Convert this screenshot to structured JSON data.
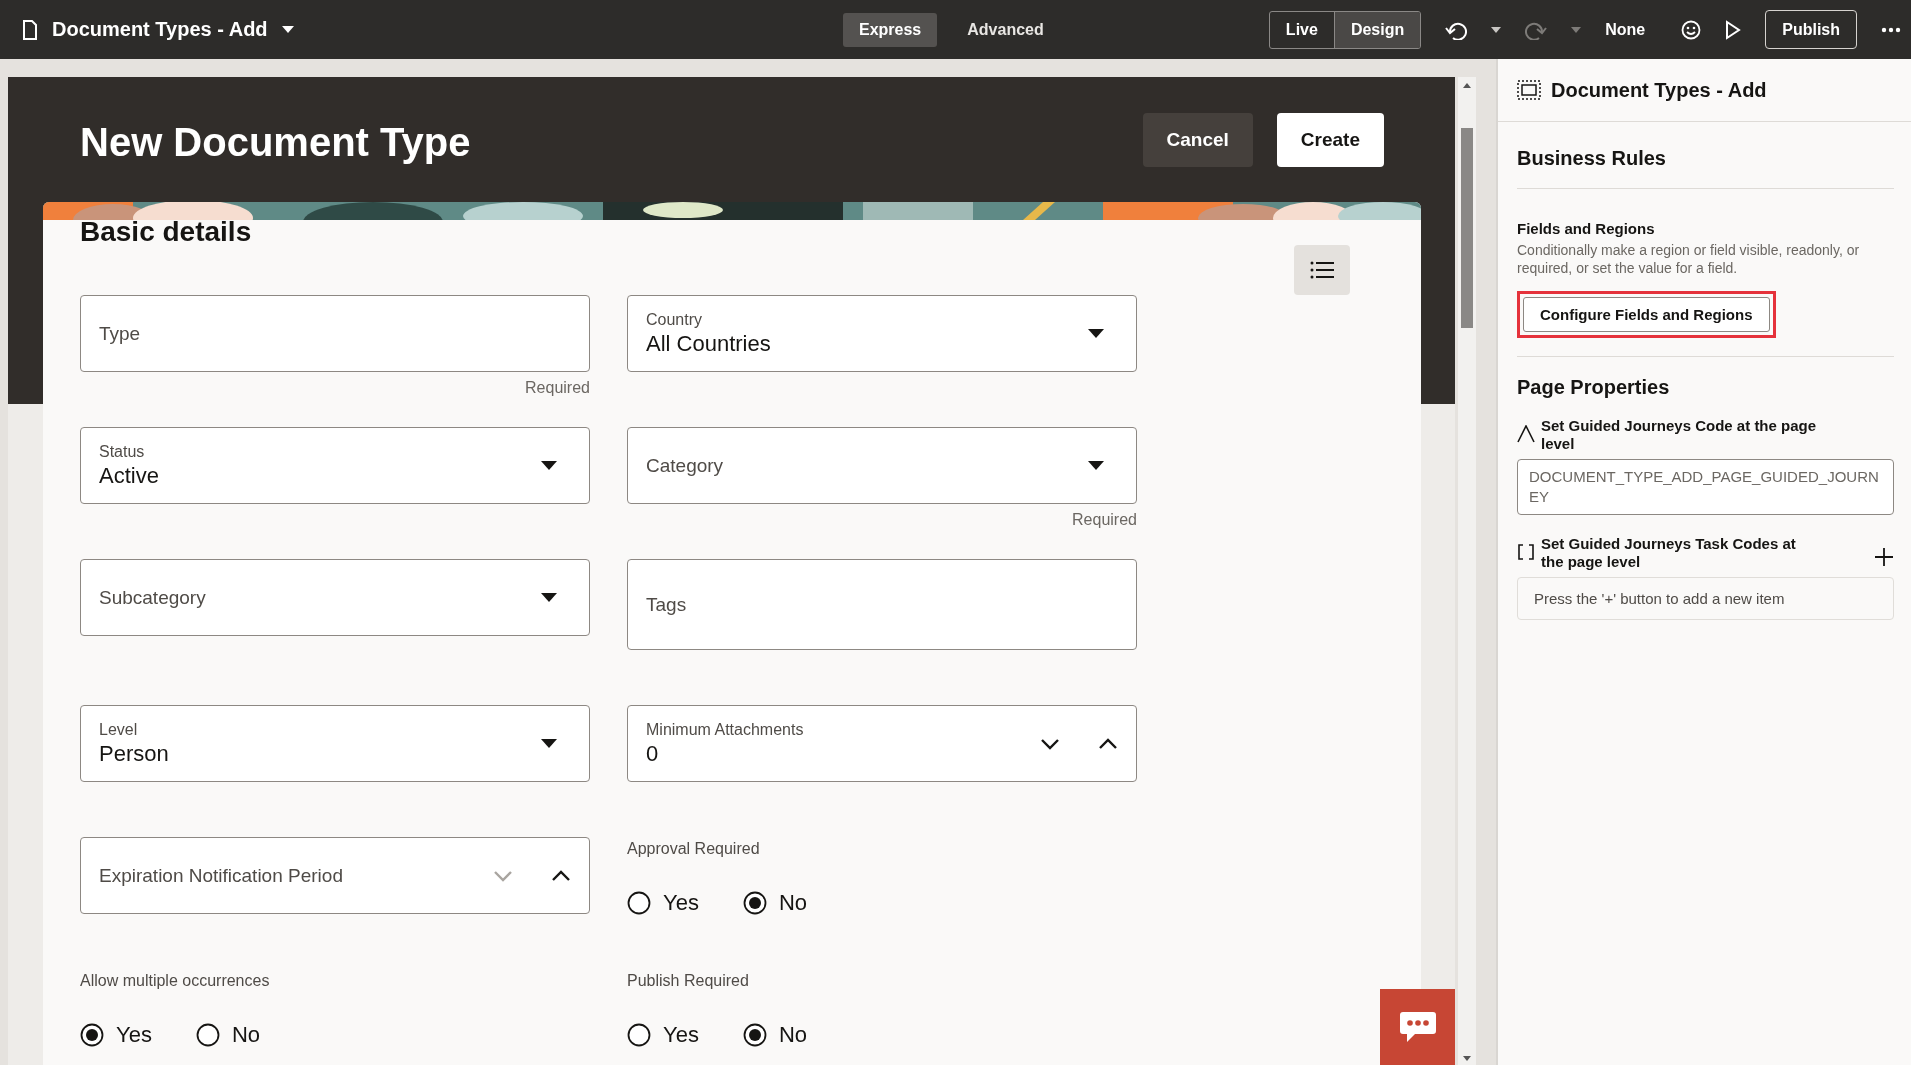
{
  "topbar": {
    "title": "Document Types - Add",
    "modes": [
      {
        "label": "Express",
        "selected": true
      },
      {
        "label": "Advanced",
        "selected": false
      }
    ],
    "views": [
      {
        "label": "Live",
        "selected": false
      },
      {
        "label": "Design",
        "selected": true
      }
    ],
    "sandbox": "None",
    "publish": "Publish"
  },
  "page": {
    "title": "New Document Type",
    "actions": [
      {
        "label": "Cancel",
        "kind": "secondary"
      },
      {
        "label": "Create",
        "kind": "primary"
      }
    ],
    "section": "Basic details",
    "fields": [
      {
        "kind": "text",
        "label": "Type",
        "helper": "Required"
      },
      {
        "kind": "select",
        "label": "Country",
        "value": "All Countries"
      },
      {
        "kind": "select",
        "label": "Status",
        "value": "Active"
      },
      {
        "kind": "select",
        "label": "Category",
        "helper": "Required"
      },
      {
        "kind": "select",
        "label": "Subcategory"
      },
      {
        "kind": "textarea",
        "label": "Tags"
      },
      {
        "kind": "select",
        "label": "Level",
        "value": "Person"
      },
      {
        "kind": "number",
        "label": "Minimum Attachments",
        "value": "0",
        "decrement_disabled": false
      },
      {
        "kind": "number",
        "label": "Expiration Notification Period",
        "decrement_disabled": true
      },
      {
        "kind": "radio",
        "label": "Approval Required",
        "options": [
          {
            "label": "Yes",
            "selected": false
          },
          {
            "label": "No",
            "selected": true
          }
        ]
      },
      {
        "kind": "radio",
        "label": "Allow multiple occurrences",
        "options": [
          {
            "label": "Yes",
            "selected": true
          },
          {
            "label": "No",
            "selected": false
          }
        ]
      },
      {
        "kind": "radio",
        "label": "Publish Required",
        "options": [
          {
            "label": "Yes",
            "selected": false
          },
          {
            "label": "No",
            "selected": true
          }
        ]
      }
    ]
  },
  "panel": {
    "title": "Document Types - Add",
    "heading": "Business Rules",
    "rule": {
      "title": "Fields and Regions",
      "description": "Conditionally make a region or field visible, readonly, or required, or set the value for a field.",
      "button": "Configure Fields and Regions",
      "highlighted": true
    },
    "properties_heading": "Page Properties",
    "properties": [
      {
        "kind": "text",
        "label": "Set Guided Journeys Code at the page level",
        "value": "DOCUMENT_TYPE_ADD_PAGE_GUIDED_JOURNEY"
      },
      {
        "kind": "list",
        "label": "Set Guided Journeys Task Codes at the page level",
        "empty_message": "Press the '+' button to add a new item"
      }
    ]
  }
}
